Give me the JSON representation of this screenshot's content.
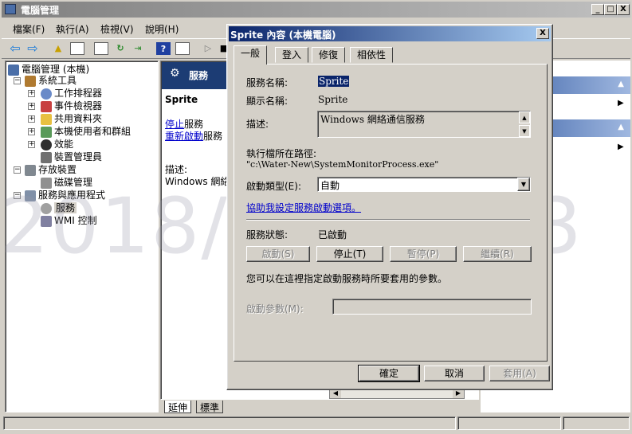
{
  "main_window": {
    "title": "電腦管理",
    "menu": [
      "檔案(F)",
      "執行(A)",
      "檢視(V)",
      "說明(H)"
    ],
    "caption": {
      "minimize": "_",
      "maximize": "□",
      "close": "X"
    }
  },
  "tree": {
    "root": "電腦管理 (本機)",
    "items": [
      {
        "label": "系統工具"
      },
      {
        "label": "工作排程器"
      },
      {
        "label": "事件檢視器"
      },
      {
        "label": "共用資料夾"
      },
      {
        "label": "本機使用者和群組"
      },
      {
        "label": "效能"
      },
      {
        "label": "裝置管理員"
      },
      {
        "label": "存放裝置"
      },
      {
        "label": "磁碟管理"
      },
      {
        "label": "服務與應用程式"
      },
      {
        "label": "服務"
      },
      {
        "label": "WMI 控制"
      }
    ]
  },
  "center": {
    "header": "服務",
    "service_name": "Sprite",
    "stop_link": "停止",
    "stop_suffix": "服務",
    "restart_link": "重新啟動",
    "restart_suffix": "服務",
    "desc_label": "描述:",
    "desc_value": "Windows 網絡通",
    "tabs": [
      "延伸",
      "標準"
    ]
  },
  "dialog": {
    "title": "Sprite 內容 (本機電腦)",
    "close": "X",
    "tabs": [
      "一般",
      "登入",
      "修復",
      "相依性"
    ],
    "service_name_label": "服務名稱:",
    "service_name_value": "Sprite",
    "display_name_label": "顯示名稱:",
    "display_name_value": "Sprite",
    "description_label": "描述:",
    "description_value": "Windows 網絡通信服務",
    "exe_path_label": "執行檔所在路徑:",
    "exe_path_value": "\"c:\\Water-New\\SystemMonitorProcess.exe\"",
    "startup_type_label": "啟動類型(E):",
    "startup_type_value": "自動",
    "help_link": "協助我設定服務啟動選項。",
    "status_label": "服務狀態:",
    "status_value": "已啟動",
    "start_button": "啟動(S)",
    "stop_button": "停止(T)",
    "pause_button": "暫停(P)",
    "resume_button": "繼續(R)",
    "params_hint": "您可以在這裡指定啟動服務時所要套用的參數。",
    "params_label": "啟動參數(M):",
    "params_value": "",
    "ok_button": "確定",
    "cancel_button": "取消",
    "apply_button": "套用(A)"
  },
  "watermark": "2018/11/27 13",
  "colors": {
    "active_title": "#0a246a",
    "link": "#0000cc",
    "face": "#d4d0c8"
  }
}
